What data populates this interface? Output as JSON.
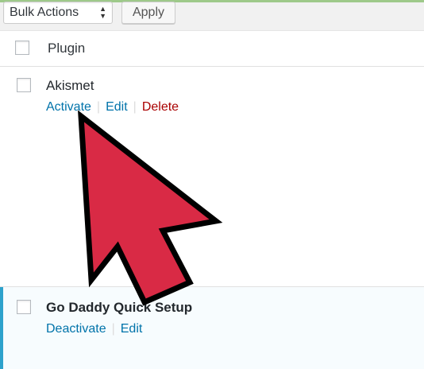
{
  "toolbar": {
    "bulk_actions_label": "Bulk Actions",
    "apply_label": "Apply"
  },
  "table": {
    "column_header": "Plugin"
  },
  "plugins": [
    {
      "name": "Akismet",
      "status": "inactive",
      "actions": [
        "Activate",
        "Edit",
        "Delete"
      ]
    },
    {
      "name": "Go Daddy Quick Setup",
      "status": "active",
      "actions": [
        "Deactivate",
        "Edit"
      ]
    }
  ],
  "colors": {
    "link": "#0073aa",
    "delete": "#aa0000",
    "active_bar": "#2ea2cc",
    "cursor_fill": "#d92a45"
  },
  "icons": {
    "bulk_select_chevron": "up-down-chevron-icon",
    "pointer": "arrow-cursor-icon"
  }
}
